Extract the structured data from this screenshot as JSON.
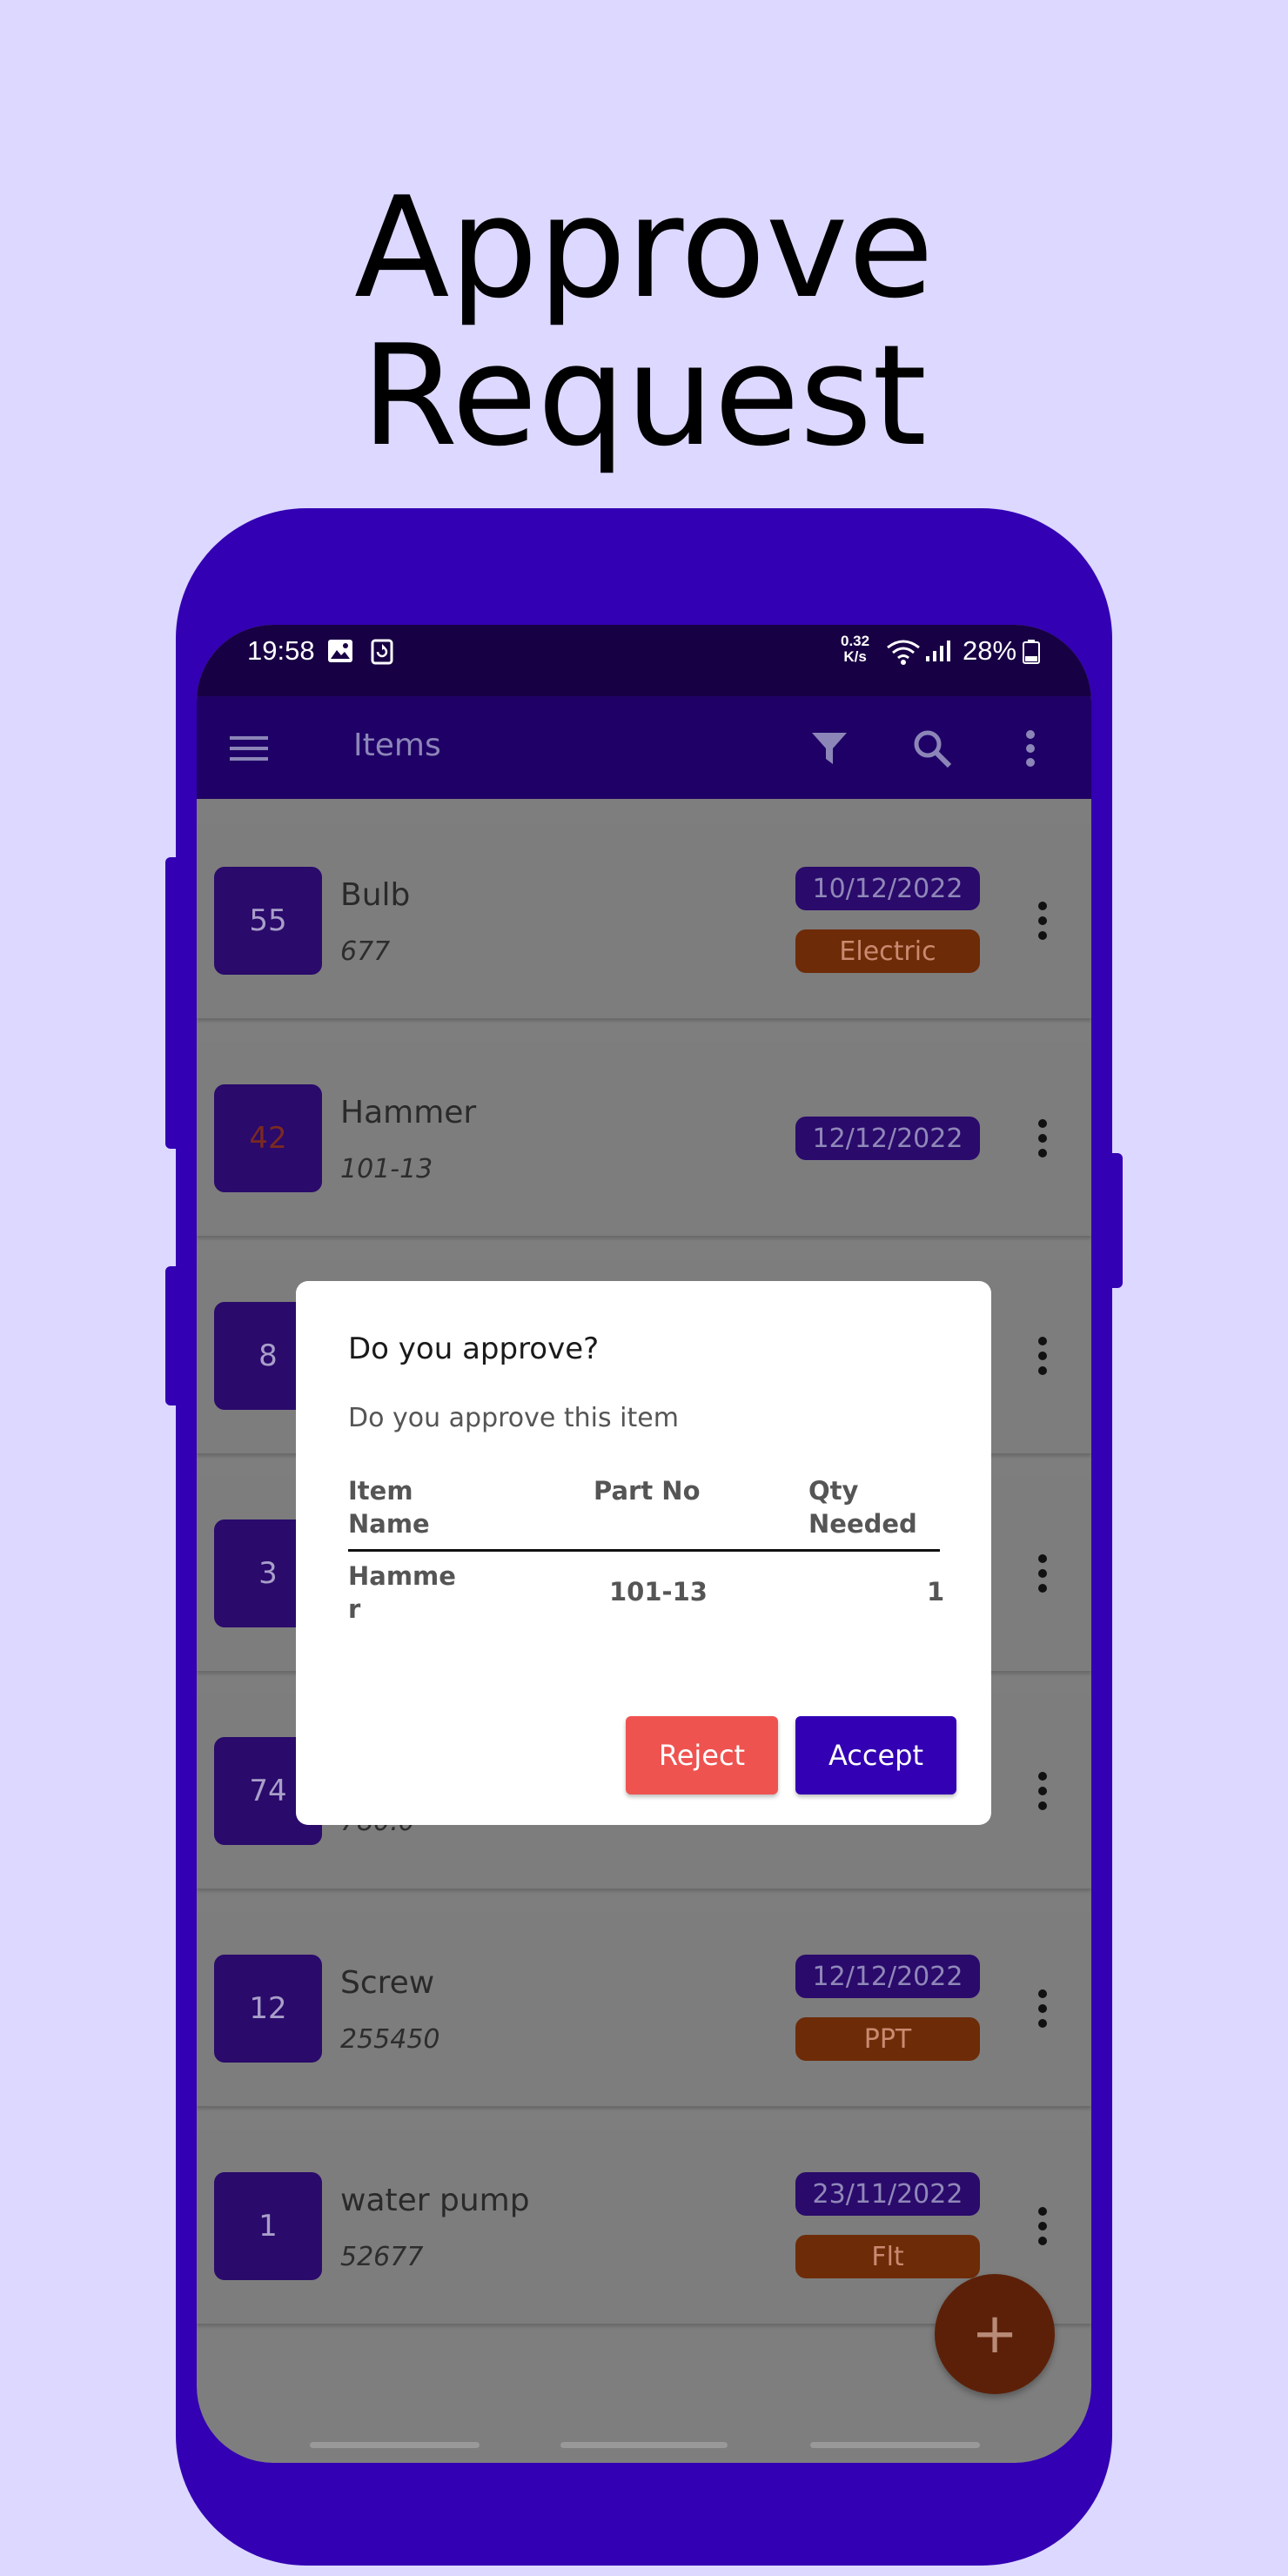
{
  "hero": {
    "line1": "Approve",
    "line2": "Request"
  },
  "status_bar": {
    "time": "19:58",
    "speed_top": "0.32",
    "speed_bottom": "K/s",
    "battery": "28%"
  },
  "app_bar": {
    "title": "Items",
    "menu_icon": "hamburger-icon",
    "filter_icon": "filter-icon",
    "search_icon": "search-icon",
    "more_icon": "more-vert-icon"
  },
  "items": [
    {
      "qty": "55",
      "name": "Bulb",
      "part": "677",
      "date": "10/12/2022",
      "category": "Electric"
    },
    {
      "qty": "42",
      "name": "Hammer",
      "part": "101-13",
      "date": "12/12/2022",
      "category": ""
    },
    {
      "qty": "8",
      "name": "",
      "part": "",
      "date": "",
      "category": ""
    },
    {
      "qty": "3",
      "name": "",
      "part": "",
      "date": "",
      "category": ""
    },
    {
      "qty": "74",
      "name": "",
      "part": "780.0",
      "date": "",
      "category": ""
    },
    {
      "qty": "12",
      "name": "Screw",
      "part": "255450",
      "date": "12/12/2022",
      "category": "PPT"
    },
    {
      "qty": "1",
      "name": "water pump",
      "part": "52677",
      "date": "23/11/2022",
      "category": "Flt"
    }
  ],
  "fab": {
    "label": "+"
  },
  "dialog": {
    "title": "Do you approve?",
    "message": "Do you approve this item",
    "headers": {
      "item_name_1": "Item",
      "item_name_2": "Name",
      "part_no": "Part No",
      "qty_1": "Qty",
      "qty_2": "Needed"
    },
    "row": {
      "item_name_1": "Hamme",
      "item_name_2": "r",
      "part_no": "101-13",
      "qty": "1"
    },
    "reject_label": "Reject",
    "accept_label": "Accept"
  },
  "colors": {
    "background": "#dcd8ff",
    "phone": "#3300b3",
    "primary": "#3300b3",
    "reject": "#ef5350",
    "category": "#6e2b08"
  }
}
